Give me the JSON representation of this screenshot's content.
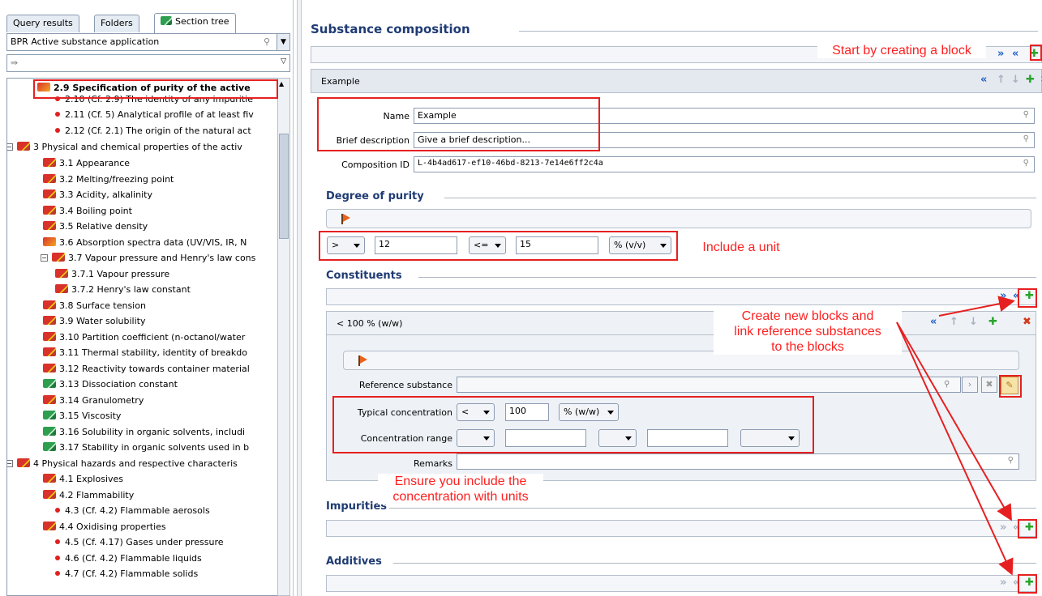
{
  "left": {
    "tabs": [
      "Query results",
      "Folders",
      "Section tree"
    ],
    "filter_combo": "BPR Active substance application",
    "tree": [
      {
        "label": "2.9 Specification of purity of the active",
        "icon": "question-book-icon",
        "bold": true
      },
      {
        "label": "2.10 (Cf. 2.9) The identity of any impuritie",
        "icon": "red-dot-icon"
      },
      {
        "label": "2.11 (Cf. 5) Analytical profile of at least fiv",
        "icon": "red-dot-icon"
      },
      {
        "label": "2.12 (Cf. 2.1) The origin of the natural act",
        "icon": "red-dot-icon"
      },
      {
        "label": "3 Physical and chemical properties of the activ",
        "icon": "red-book-icon"
      },
      {
        "label": "3.1 Appearance",
        "icon": "red-book-icon"
      },
      {
        "label": "3.2 Melting/freezing point",
        "icon": "red-book-icon"
      },
      {
        "label": "3.3 Acidity, alkalinity",
        "icon": "red-book-icon"
      },
      {
        "label": "3.4 Boiling point",
        "icon": "red-book-icon"
      },
      {
        "label": "3.5 Relative density",
        "icon": "red-book-icon"
      },
      {
        "label": "3.6 Absorption spectra data (UV/VIS, IR, N",
        "icon": "question-book-icon"
      },
      {
        "label": "3.7 Vapour pressure and Henry's law cons",
        "icon": "red-book-icon"
      },
      {
        "label": "3.7.1 Vapour pressure",
        "icon": "red-book-icon"
      },
      {
        "label": "3.7.2 Henry's law constant",
        "icon": "red-book-icon"
      },
      {
        "label": "3.8 Surface tension",
        "icon": "red-book-icon"
      },
      {
        "label": "3.9 Water solubility",
        "icon": "red-book-icon"
      },
      {
        "label": "3.10 Partition coefficient (n-octanol/water",
        "icon": "red-book-icon"
      },
      {
        "label": "3.11 Thermal stability, identity of breakdo",
        "icon": "red-book-icon"
      },
      {
        "label": "3.12 Reactivity towards container material",
        "icon": "red-book-icon"
      },
      {
        "label": "3.13 Dissociation constant",
        "icon": "green-book-icon"
      },
      {
        "label": "3.14 Granulometry",
        "icon": "red-book-icon"
      },
      {
        "label": "3.15 Viscosity",
        "icon": "green-book-icon"
      },
      {
        "label": "3.16 Solubility in organic solvents, includi",
        "icon": "green-book-icon"
      },
      {
        "label": "3.17 Stability in organic solvents used in b",
        "icon": "green-book-icon"
      },
      {
        "label": "4 Physical hazards and respective characteris",
        "icon": "red-book-icon"
      },
      {
        "label": "4.1 Explosives",
        "icon": "red-book-icon"
      },
      {
        "label": "4.2 Flammability",
        "icon": "red-book-icon"
      },
      {
        "label": "4.3 (Cf. 4.2) Flammable aerosols",
        "icon": "red-dot-icon"
      },
      {
        "label": "4.4 Oxidising properties",
        "icon": "red-book-icon"
      },
      {
        "label": "4.5 (Cf. 4.17) Gases under pressure",
        "icon": "red-dot-icon"
      },
      {
        "label": "4.6 (Cf. 4.2) Flammable liquids",
        "icon": "red-dot-icon"
      },
      {
        "label": "4.7 (Cf. 4.2) Flammable solids",
        "icon": "red-dot-icon"
      }
    ]
  },
  "main": {
    "title": "Substance composition",
    "block_title": "Example",
    "name_label": "Name",
    "name_value": "Example",
    "brief_label": "Brief description",
    "brief_value": "Give a brief description...",
    "compid_label": "Composition ID",
    "compid_value": "L-4b4ad617-ef10-46bd-8213-7e14e6ff2c4a",
    "purity_title": "Degree of purity",
    "purity": {
      "op1": ">",
      "val1": "12",
      "op2": "<=",
      "val2": "15",
      "unit": "% (v/v)"
    },
    "constituents_title": "Constituents",
    "constituent_block_title": "< 100 % (w/w)",
    "ref_label": "Reference substance",
    "typical_label": "Typical concentration",
    "typical": {
      "op": "<",
      "value": "100",
      "unit": "% (w/w)"
    },
    "range_label": "Concentration range",
    "remarks_label": "Remarks",
    "impurities_title": "Impurities",
    "additives_title": "Additives"
  },
  "annotations": {
    "start": "Start by creating a block",
    "unit": "Include a unit",
    "create": "Create new blocks and\nlink reference substances\nto the blocks",
    "ensure": "Ensure you include the\nconcentration with units"
  },
  "colors": {
    "annotation": "#e62020",
    "section_title": "#1f3b73",
    "plus_icon": "#2aa52a"
  }
}
